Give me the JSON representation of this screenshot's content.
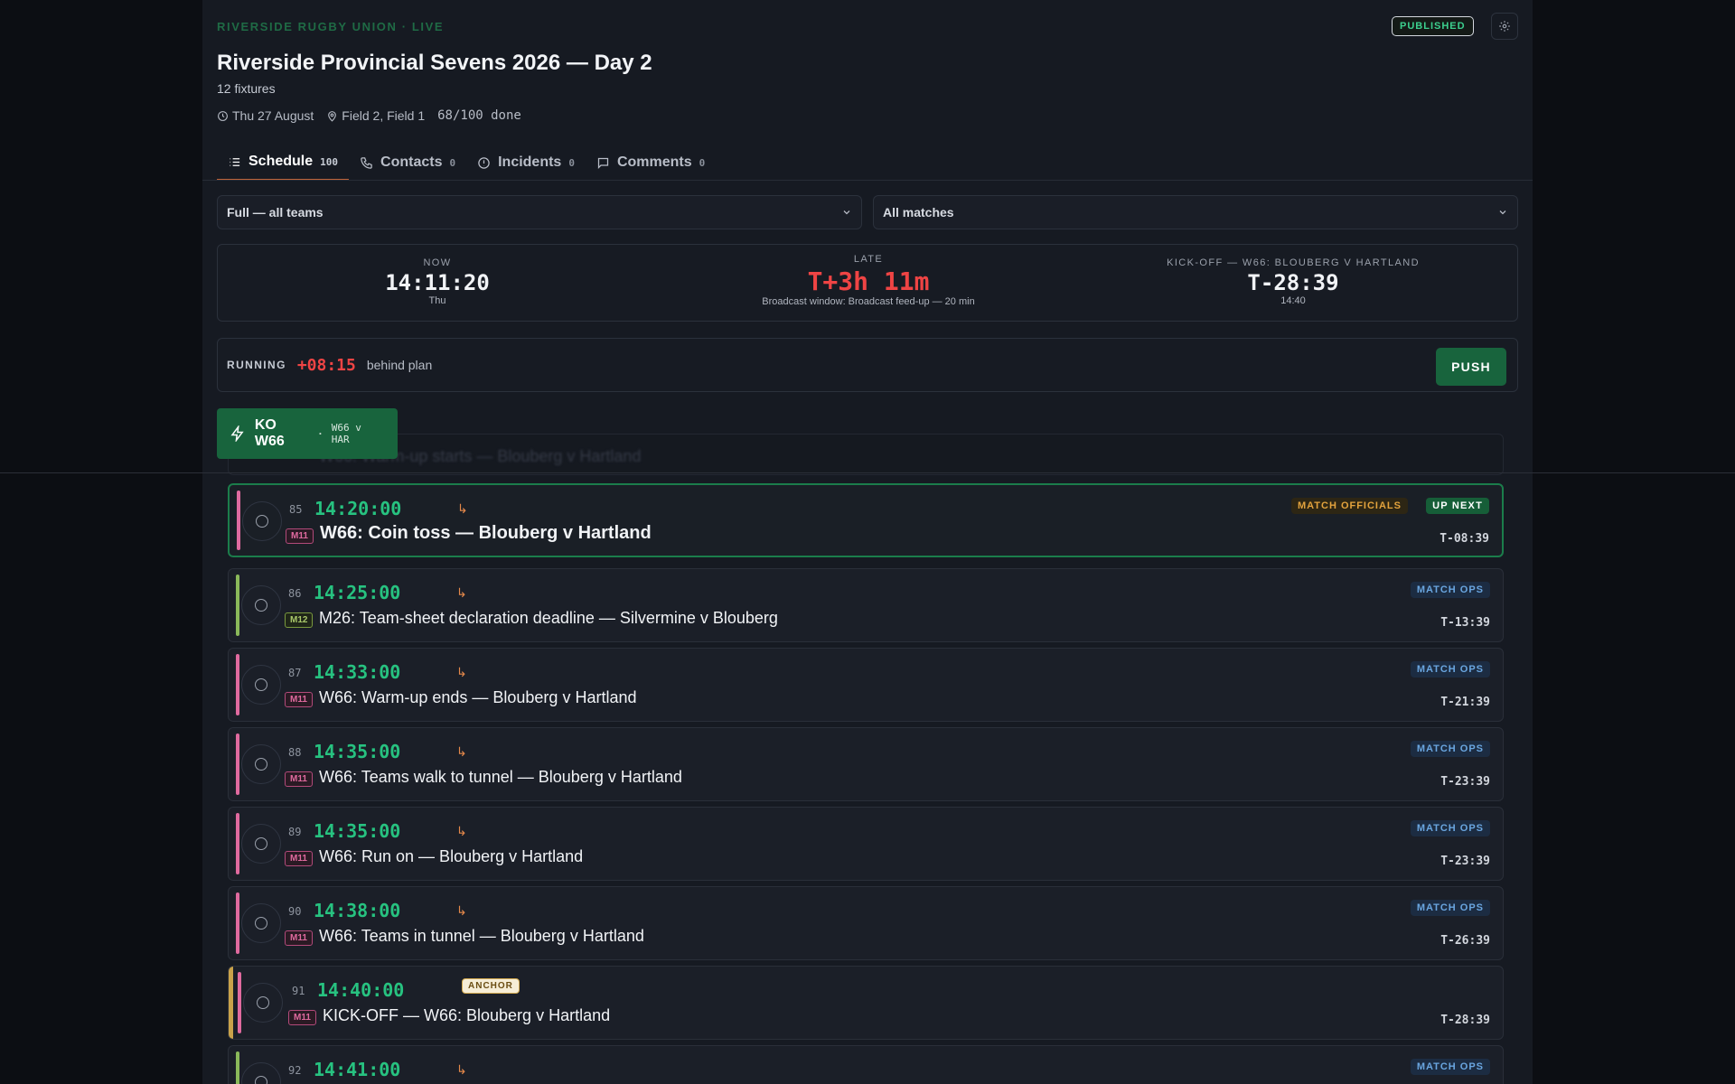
{
  "header": {
    "org": "RIVERSIDE RUGBY UNION · LIVE",
    "status_badge": "PUBLISHED",
    "title": "Riverside Provincial Sevens 2026 — Day 2",
    "subtitle": "12 fixtures",
    "date": "Thu 27 August",
    "venue": "Field 2, Field 1",
    "progress": "68/100 done",
    "progress_fraction": 0.68
  },
  "tabs": [
    {
      "label": "Schedule",
      "count": "100",
      "icon": "list-icon",
      "active": true
    },
    {
      "label": "Contacts",
      "count": "0",
      "icon": "phone-icon"
    },
    {
      "label": "Incidents",
      "count": "0",
      "icon": "alert-icon"
    },
    {
      "label": "Comments",
      "count": "0",
      "icon": "comment-icon"
    }
  ],
  "filters": {
    "view": "Full — all teams",
    "matches": "All matches"
  },
  "clock": {
    "now_label": "NOW",
    "now_value": "14:11:20",
    "now_day": "Thu",
    "late_label": "LATE",
    "late_value": "T+3h 11m",
    "late_note": "Broadcast window: Broadcast feed-up — 20 min",
    "kickoff_label": "KICK-OFF — W66: BLOUBERG V HARTLAND",
    "kickoff_value": "T-28:39",
    "kickoff_time": "14:40"
  },
  "running": {
    "label": "RUNNING",
    "value": "+08:15",
    "note": "behind plan",
    "push_label": "PUSH"
  },
  "ko_button": {
    "label": "KO W66",
    "separator": "·",
    "sub": "W66 v HAR"
  },
  "ghost_row": {
    "text": "W66: Warm-up starts — Blouberg v Hartland"
  },
  "rows": [
    {
      "num": "85",
      "time": "14:20:00",
      "match": "M11",
      "label": "W66: Coin toss — Blouberg v Hartland",
      "category": "MATCH OFFICIALS",
      "badge": "UP NEXT",
      "countdown": "T-08:39",
      "arrow": "↳"
    },
    {
      "num": "86",
      "time": "14:25:00",
      "match": "M12",
      "label": "M26: Team-sheet declaration deadline — Silvermine v Blouberg",
      "category": "MATCH OPS",
      "countdown": "T-13:39",
      "arrow": "↳"
    },
    {
      "num": "87",
      "time": "14:33:00",
      "match": "M11",
      "label": "W66: Warm-up ends — Blouberg v Hartland",
      "category": "MATCH OPS",
      "countdown": "T-21:39",
      "arrow": "↳"
    },
    {
      "num": "88",
      "time": "14:35:00",
      "match": "M11",
      "label": "W66: Teams walk to tunnel — Blouberg v Hartland",
      "category": "MATCH OPS",
      "countdown": "T-23:39",
      "arrow": "↳"
    },
    {
      "num": "89",
      "time": "14:35:00",
      "match": "M11",
      "label": "W66: Run on — Blouberg v Hartland",
      "category": "MATCH OPS",
      "countdown": "T-23:39",
      "arrow": "↳"
    },
    {
      "num": "90",
      "time": "14:38:00",
      "match": "M11",
      "label": "W66: Teams in tunnel — Blouberg v Hartland",
      "category": "MATCH OPS",
      "countdown": "T-26:39",
      "arrow": "↳"
    },
    {
      "num": "91",
      "time": "14:40:00",
      "match": "M11",
      "label": "KICK-OFF — W66: Blouberg v Hartland",
      "anchor": "ANCHOR",
      "countdown": "T-28:39"
    },
    {
      "num": "92",
      "time": "14:41:00",
      "category": "MATCH OPS",
      "arrow": "↳"
    }
  ],
  "colors": {
    "accent_green": "#27c280",
    "late_red": "#ef4444",
    "m11_pink": "#e06a9f",
    "m12_green": "#a9c86a",
    "anchor_gold": "#d3a94e"
  }
}
